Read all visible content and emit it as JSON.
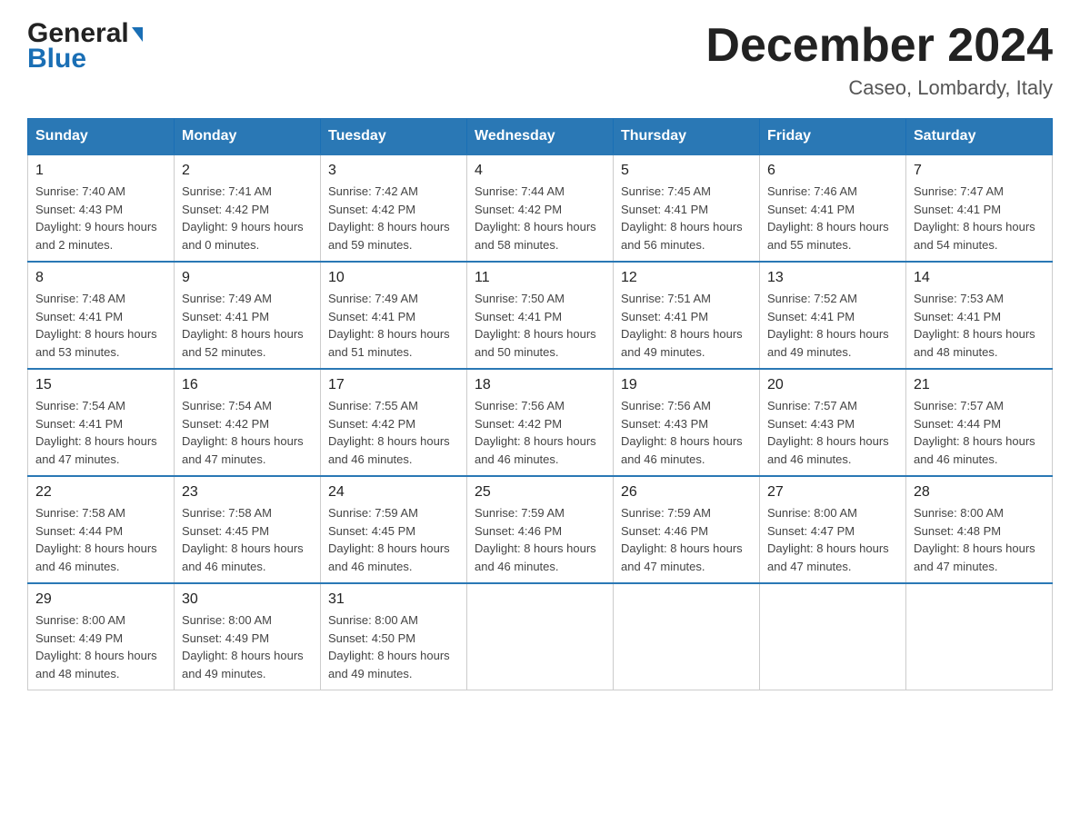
{
  "logo": {
    "general": "General",
    "blue": "Blue",
    "triangle": "▶"
  },
  "title": "December 2024",
  "location": "Caseo, Lombardy, Italy",
  "days_of_week": [
    "Sunday",
    "Monday",
    "Tuesday",
    "Wednesday",
    "Thursday",
    "Friday",
    "Saturday"
  ],
  "weeks": [
    [
      {
        "day": "1",
        "sunrise": "7:40 AM",
        "sunset": "4:43 PM",
        "daylight": "9 hours and 2 minutes."
      },
      {
        "day": "2",
        "sunrise": "7:41 AM",
        "sunset": "4:42 PM",
        "daylight": "9 hours and 0 minutes."
      },
      {
        "day": "3",
        "sunrise": "7:42 AM",
        "sunset": "4:42 PM",
        "daylight": "8 hours and 59 minutes."
      },
      {
        "day": "4",
        "sunrise": "7:44 AM",
        "sunset": "4:42 PM",
        "daylight": "8 hours and 58 minutes."
      },
      {
        "day": "5",
        "sunrise": "7:45 AM",
        "sunset": "4:41 PM",
        "daylight": "8 hours and 56 minutes."
      },
      {
        "day": "6",
        "sunrise": "7:46 AM",
        "sunset": "4:41 PM",
        "daylight": "8 hours and 55 minutes."
      },
      {
        "day": "7",
        "sunrise": "7:47 AM",
        "sunset": "4:41 PM",
        "daylight": "8 hours and 54 minutes."
      }
    ],
    [
      {
        "day": "8",
        "sunrise": "7:48 AM",
        "sunset": "4:41 PM",
        "daylight": "8 hours and 53 minutes."
      },
      {
        "day": "9",
        "sunrise": "7:49 AM",
        "sunset": "4:41 PM",
        "daylight": "8 hours and 52 minutes."
      },
      {
        "day": "10",
        "sunrise": "7:49 AM",
        "sunset": "4:41 PM",
        "daylight": "8 hours and 51 minutes."
      },
      {
        "day": "11",
        "sunrise": "7:50 AM",
        "sunset": "4:41 PM",
        "daylight": "8 hours and 50 minutes."
      },
      {
        "day": "12",
        "sunrise": "7:51 AM",
        "sunset": "4:41 PM",
        "daylight": "8 hours and 49 minutes."
      },
      {
        "day": "13",
        "sunrise": "7:52 AM",
        "sunset": "4:41 PM",
        "daylight": "8 hours and 49 minutes."
      },
      {
        "day": "14",
        "sunrise": "7:53 AM",
        "sunset": "4:41 PM",
        "daylight": "8 hours and 48 minutes."
      }
    ],
    [
      {
        "day": "15",
        "sunrise": "7:54 AM",
        "sunset": "4:41 PM",
        "daylight": "8 hours and 47 minutes."
      },
      {
        "day": "16",
        "sunrise": "7:54 AM",
        "sunset": "4:42 PM",
        "daylight": "8 hours and 47 minutes."
      },
      {
        "day": "17",
        "sunrise": "7:55 AM",
        "sunset": "4:42 PM",
        "daylight": "8 hours and 46 minutes."
      },
      {
        "day": "18",
        "sunrise": "7:56 AM",
        "sunset": "4:42 PM",
        "daylight": "8 hours and 46 minutes."
      },
      {
        "day": "19",
        "sunrise": "7:56 AM",
        "sunset": "4:43 PM",
        "daylight": "8 hours and 46 minutes."
      },
      {
        "day": "20",
        "sunrise": "7:57 AM",
        "sunset": "4:43 PM",
        "daylight": "8 hours and 46 minutes."
      },
      {
        "day": "21",
        "sunrise": "7:57 AM",
        "sunset": "4:44 PM",
        "daylight": "8 hours and 46 minutes."
      }
    ],
    [
      {
        "day": "22",
        "sunrise": "7:58 AM",
        "sunset": "4:44 PM",
        "daylight": "8 hours and 46 minutes."
      },
      {
        "day": "23",
        "sunrise": "7:58 AM",
        "sunset": "4:45 PM",
        "daylight": "8 hours and 46 minutes."
      },
      {
        "day": "24",
        "sunrise": "7:59 AM",
        "sunset": "4:45 PM",
        "daylight": "8 hours and 46 minutes."
      },
      {
        "day": "25",
        "sunrise": "7:59 AM",
        "sunset": "4:46 PM",
        "daylight": "8 hours and 46 minutes."
      },
      {
        "day": "26",
        "sunrise": "7:59 AM",
        "sunset": "4:46 PM",
        "daylight": "8 hours and 47 minutes."
      },
      {
        "day": "27",
        "sunrise": "8:00 AM",
        "sunset": "4:47 PM",
        "daylight": "8 hours and 47 minutes."
      },
      {
        "day": "28",
        "sunrise": "8:00 AM",
        "sunset": "4:48 PM",
        "daylight": "8 hours and 47 minutes."
      }
    ],
    [
      {
        "day": "29",
        "sunrise": "8:00 AM",
        "sunset": "4:49 PM",
        "daylight": "8 hours and 48 minutes."
      },
      {
        "day": "30",
        "sunrise": "8:00 AM",
        "sunset": "4:49 PM",
        "daylight": "8 hours and 49 minutes."
      },
      {
        "day": "31",
        "sunrise": "8:00 AM",
        "sunset": "4:50 PM",
        "daylight": "8 hours and 49 minutes."
      },
      null,
      null,
      null,
      null
    ]
  ]
}
